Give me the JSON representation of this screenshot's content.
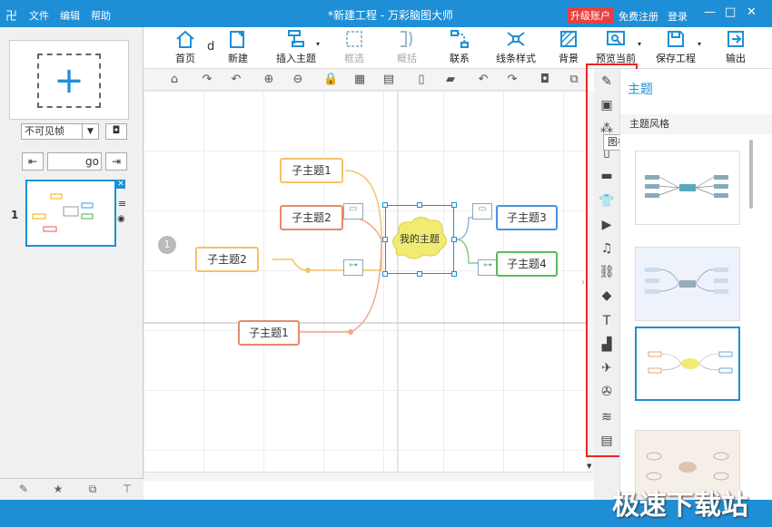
{
  "window": {
    "logo": "卍",
    "menus": [
      "文件",
      "编辑",
      "帮助"
    ],
    "title": "*新建工程 - 万彩脑图大师",
    "upgrade": "升级账户",
    "register": "免费注册",
    "login": "登录"
  },
  "toolbar": {
    "home": "首页",
    "d": "d",
    "new": "新建",
    "insert": "插入主题",
    "select": "框选",
    "summary": "概括",
    "link": "联系",
    "line": "线条样式",
    "bg": "背景",
    "preview": "预览当前",
    "save": "保存工程",
    "export": "输出"
  },
  "left": {
    "frame_select": "不可见帧",
    "nav_go": "go",
    "thumb_num": "1"
  },
  "mindmap": {
    "center": "我的主题",
    "nodes": [
      "子主题1",
      "子主题2",
      "子主题2",
      "子主题1",
      "子主题3",
      "子主题4"
    ],
    "marker": "1"
  },
  "right": {
    "tooltip": "图标",
    "panel_title": "主题",
    "panel_sub": "主题风格"
  },
  "watermark": "极速下载站"
}
